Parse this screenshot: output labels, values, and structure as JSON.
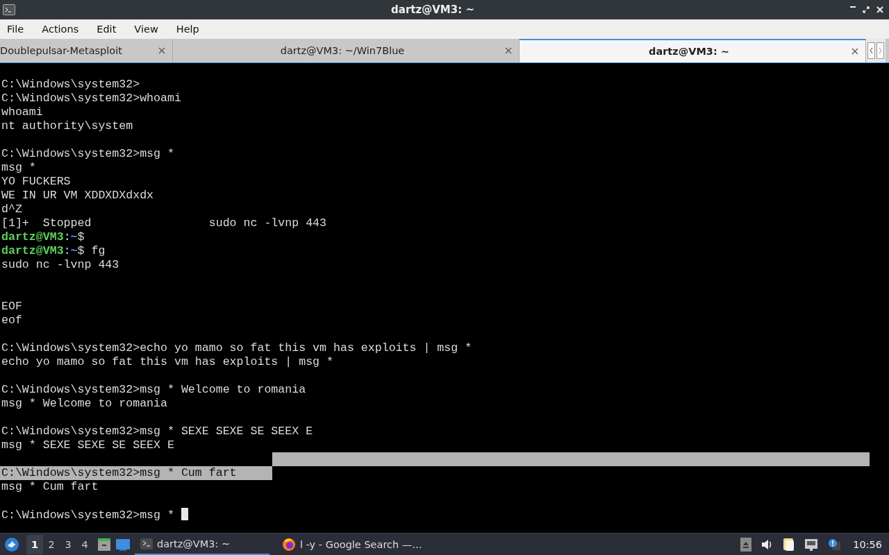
{
  "window": {
    "title": "dartz@VM3: ~"
  },
  "menu": [
    "File",
    "Actions",
    "Edit",
    "View",
    "Help"
  ],
  "tabs": [
    {
      "label": "Doublepulsar-Metasploit",
      "selected": false
    },
    {
      "label": "dartz@VM3: ~/Win7Blue",
      "selected": false
    },
    {
      "label": "dartz@VM3: ~",
      "selected": true
    }
  ],
  "terminal": {
    "lines": [
      {
        "kind": "blank"
      },
      {
        "kind": "text",
        "text": "C:\\Windows\\system32>"
      },
      {
        "kind": "text",
        "text": "C:\\Windows\\system32>whoami"
      },
      {
        "kind": "text",
        "text": "whoami"
      },
      {
        "kind": "text",
        "text": "nt authority\\system"
      },
      {
        "kind": "blank"
      },
      {
        "kind": "text",
        "text": "C:\\Windows\\system32>msg *"
      },
      {
        "kind": "text",
        "text": "msg *"
      },
      {
        "kind": "text",
        "text": "YO FUCKERS"
      },
      {
        "kind": "text",
        "text": "WE IN UR VM XDDXDXdxdx"
      },
      {
        "kind": "text",
        "text": "d^Z"
      },
      {
        "kind": "text",
        "text": "[1]+  Stopped                 sudo nc -lvnp 443"
      },
      {
        "kind": "prompt",
        "user": "dartz@VM3",
        "separator": ":",
        "path": "~",
        "symbol": "$"
      },
      {
        "kind": "prompt",
        "user": "dartz@VM3",
        "separator": ":",
        "path": "~",
        "symbol": "$",
        "command": " fg"
      },
      {
        "kind": "text",
        "text": "sudo nc -lvnp 443"
      },
      {
        "kind": "blank"
      },
      {
        "kind": "blank"
      },
      {
        "kind": "text",
        "text": "EOF"
      },
      {
        "kind": "text",
        "text": "eof"
      },
      {
        "kind": "blank"
      },
      {
        "kind": "text",
        "text": "C:\\Windows\\system32>echo yo mamo so fat this vm has exploits | msg *"
      },
      {
        "kind": "text",
        "text": "echo yo mamo so fat this vm has exploits | msg *"
      },
      {
        "kind": "blank"
      },
      {
        "kind": "text",
        "text": "C:\\Windows\\system32>msg * Welcome to romania"
      },
      {
        "kind": "text",
        "text": "msg * Welcome to romania"
      },
      {
        "kind": "blank"
      },
      {
        "kind": "text",
        "text": "C:\\Windows\\system32>msg * SEXE SEXE SE SEEX E"
      },
      {
        "kind": "text",
        "text": "msg * SEXE SEXE SE SEEX E"
      },
      {
        "kind": "blank",
        "selected": true
      },
      {
        "kind": "text",
        "text": "C:\\Windows\\system32>msg * Cum fart",
        "selected": true
      },
      {
        "kind": "text",
        "text": "msg * Cum fart"
      },
      {
        "kind": "blank"
      },
      {
        "kind": "text",
        "text": "C:\\Windows\\system32>msg * ",
        "cursor": true
      }
    ]
  },
  "taskbar": {
    "workspaces": [
      {
        "label": "1",
        "selected": true
      },
      {
        "label": "2",
        "selected": false
      },
      {
        "label": "3",
        "selected": false
      },
      {
        "label": "4",
        "selected": false
      }
    ],
    "tasks": [
      {
        "label": "dartz@VM3: ~",
        "kind": "terminal",
        "selected": true
      },
      {
        "label": "l -y - Google Search —…",
        "kind": "browser",
        "selected": false
      }
    ],
    "clock": "10:56"
  }
}
